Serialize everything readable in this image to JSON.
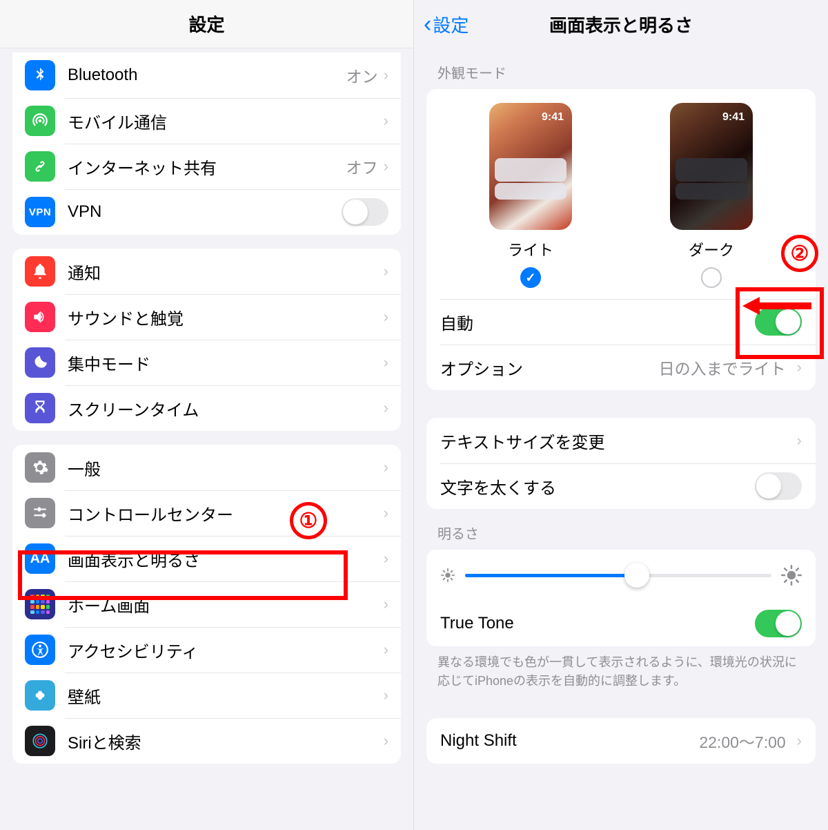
{
  "left": {
    "title": "設定",
    "groups": [
      {
        "rows": [
          {
            "id": "bluetooth",
            "label": "Bluetooth",
            "value": "オン",
            "type": "link"
          },
          {
            "id": "cellular",
            "label": "モバイル通信",
            "type": "link"
          },
          {
            "id": "hotspot",
            "label": "インターネット共有",
            "value": "オフ",
            "type": "link"
          },
          {
            "id": "vpn",
            "label": "VPN",
            "type": "toggle",
            "on": false
          }
        ]
      },
      {
        "rows": [
          {
            "id": "notifications",
            "label": "通知",
            "type": "link"
          },
          {
            "id": "sounds",
            "label": "サウンドと触覚",
            "type": "link"
          },
          {
            "id": "focus",
            "label": "集中モード",
            "type": "link"
          },
          {
            "id": "screentime",
            "label": "スクリーンタイム",
            "type": "link"
          }
        ]
      },
      {
        "rows": [
          {
            "id": "general",
            "label": "一般",
            "type": "link"
          },
          {
            "id": "controlcenter",
            "label": "コントロールセンター",
            "type": "link"
          },
          {
            "id": "display",
            "label": "画面表示と明るさ",
            "type": "link"
          },
          {
            "id": "homescreen",
            "label": "ホーム画面",
            "type": "link"
          },
          {
            "id": "accessibility",
            "label": "アクセシビリティ",
            "type": "link"
          },
          {
            "id": "wallpaper",
            "label": "壁紙",
            "type": "link"
          },
          {
            "id": "siri",
            "label": "Siriと検索",
            "type": "link"
          }
        ]
      }
    ]
  },
  "right": {
    "back": "設定",
    "title": "画面表示と明るさ",
    "sections": {
      "appearance": {
        "header": "外観モード",
        "light_label": "ライト",
        "dark_label": "ダーク",
        "selected": "light",
        "preview_time": "9:41",
        "auto_label": "自動",
        "auto_on": true,
        "options_label": "オプション",
        "options_value": "日の入までライト"
      },
      "text": {
        "textsize_label": "テキストサイズを変更",
        "bold_label": "文字を太くする",
        "bold_on": false
      },
      "brightness": {
        "header": "明るさ",
        "slider": 0.56,
        "truetone_label": "True Tone",
        "truetone_on": true,
        "footer": "異なる環境でも色が一貫して表示されるように、環境光の状況に応じてiPhoneの表示を自動的に調整します。"
      },
      "nightshift": {
        "label": "Night Shift",
        "value": "22:00〜7:00"
      }
    }
  },
  "annotations": {
    "step1": "①",
    "step2": "②"
  }
}
